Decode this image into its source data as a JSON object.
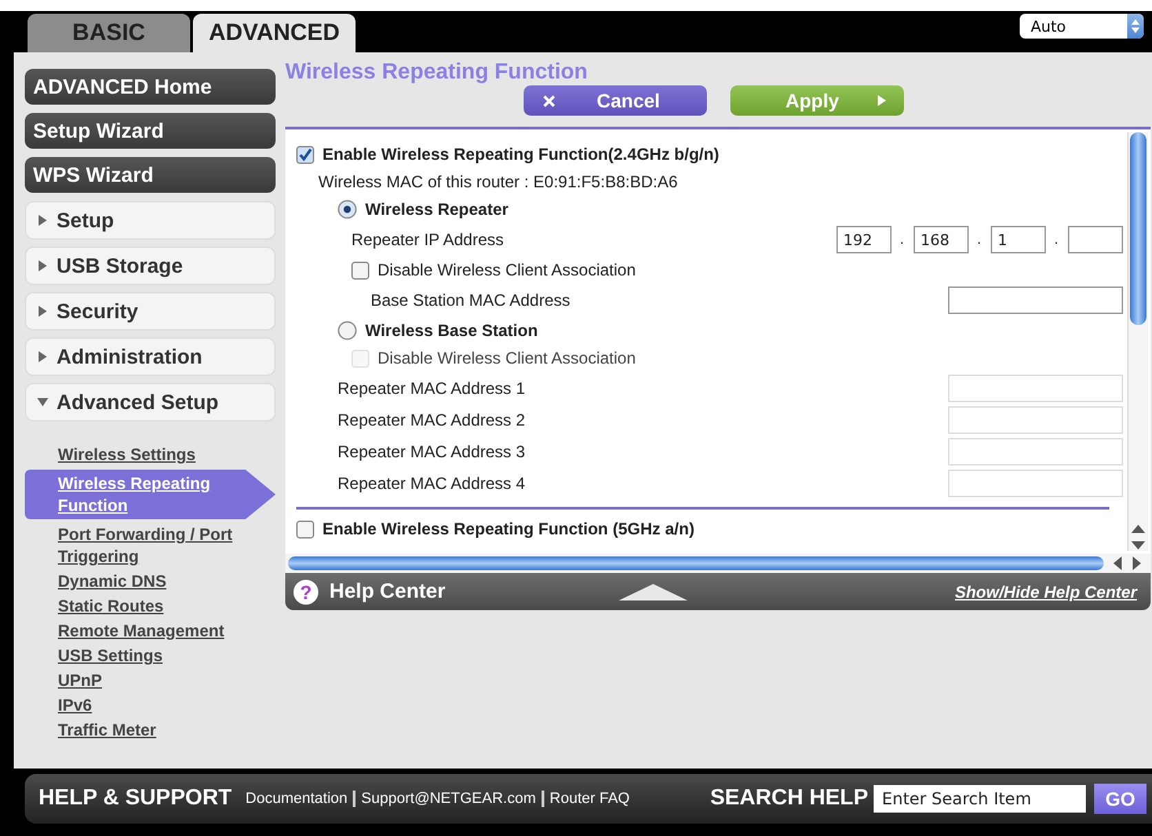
{
  "top_tabs": [
    {
      "label": "BASIC",
      "selected": false
    },
    {
      "label": "ADVANCED",
      "selected": true
    }
  ],
  "language_select": {
    "value": "Auto"
  },
  "sidebar": {
    "buttons": [
      "ADVANCED Home",
      "Setup Wizard",
      "WPS Wizard"
    ],
    "sections": [
      {
        "label": "Setup",
        "expanded": false
      },
      {
        "label": "USB Storage",
        "expanded": false
      },
      {
        "label": "Security",
        "expanded": false
      },
      {
        "label": "Administration",
        "expanded": false
      },
      {
        "label": "Advanced Setup",
        "expanded": true
      }
    ],
    "links": [
      {
        "label": "Wireless Settings",
        "selected": false
      },
      {
        "label": "Wireless Repeating Function",
        "selected": true
      },
      {
        "label": "Port Forwarding / Port Triggering",
        "selected": false
      },
      {
        "label": "Dynamic DNS",
        "selected": false
      },
      {
        "label": "Static Routes",
        "selected": false
      },
      {
        "label": "Remote Management",
        "selected": false
      },
      {
        "label": "USB Settings",
        "selected": false
      },
      {
        "label": "UPnP",
        "selected": false
      },
      {
        "label": "IPv6",
        "selected": false
      },
      {
        "label": "Traffic Meter",
        "selected": false
      }
    ]
  },
  "content": {
    "title": "Wireless Repeating Function",
    "cancel_button": "Cancel",
    "apply_button": "Apply",
    "enable_24": {
      "label": "Enable Wireless Repeating Function(2.4GHz b/g/n)",
      "checked": true
    },
    "mac_line": "Wireless MAC of this router : E0:91:F5:B8:BD:A6",
    "repeater": {
      "label": "Wireless Repeater",
      "selected": true,
      "ip_label": "Repeater IP Address",
      "ip_separator": ".",
      "ip_octets": [
        "192",
        "168",
        "1"
      ],
      "disable_association": {
        "label": "Disable Wireless Client Association",
        "checked": false,
        "disabled": false
      },
      "base_mac_label": "Base Station MAC Address"
    },
    "base_station": {
      "label": "Wireless Base Station",
      "selected": false,
      "disable_association": {
        "label": "Disable Wireless Client Association",
        "checked": false,
        "disabled": true
      },
      "repeater_mac_labels": [
        "Repeater MAC Address 1",
        "Repeater MAC Address 2",
        "Repeater MAC Address 3",
        "Repeater MAC Address 4"
      ]
    },
    "enable_5g": {
      "label": "Enable Wireless Repeating Function (5GHz a/n)",
      "checked": false
    }
  },
  "help_center": {
    "icon_glyph": "?",
    "title": "Help Center",
    "toggle_link": "Show/Hide Help Center"
  },
  "footer": {
    "title": "HELP & SUPPORT",
    "links": [
      "Documentation",
      "Support@NETGEAR.com",
      "Router FAQ"
    ],
    "search_title": "SEARCH HELP",
    "search_placeholder": "Enter Search Item",
    "go_button": "GO"
  }
}
